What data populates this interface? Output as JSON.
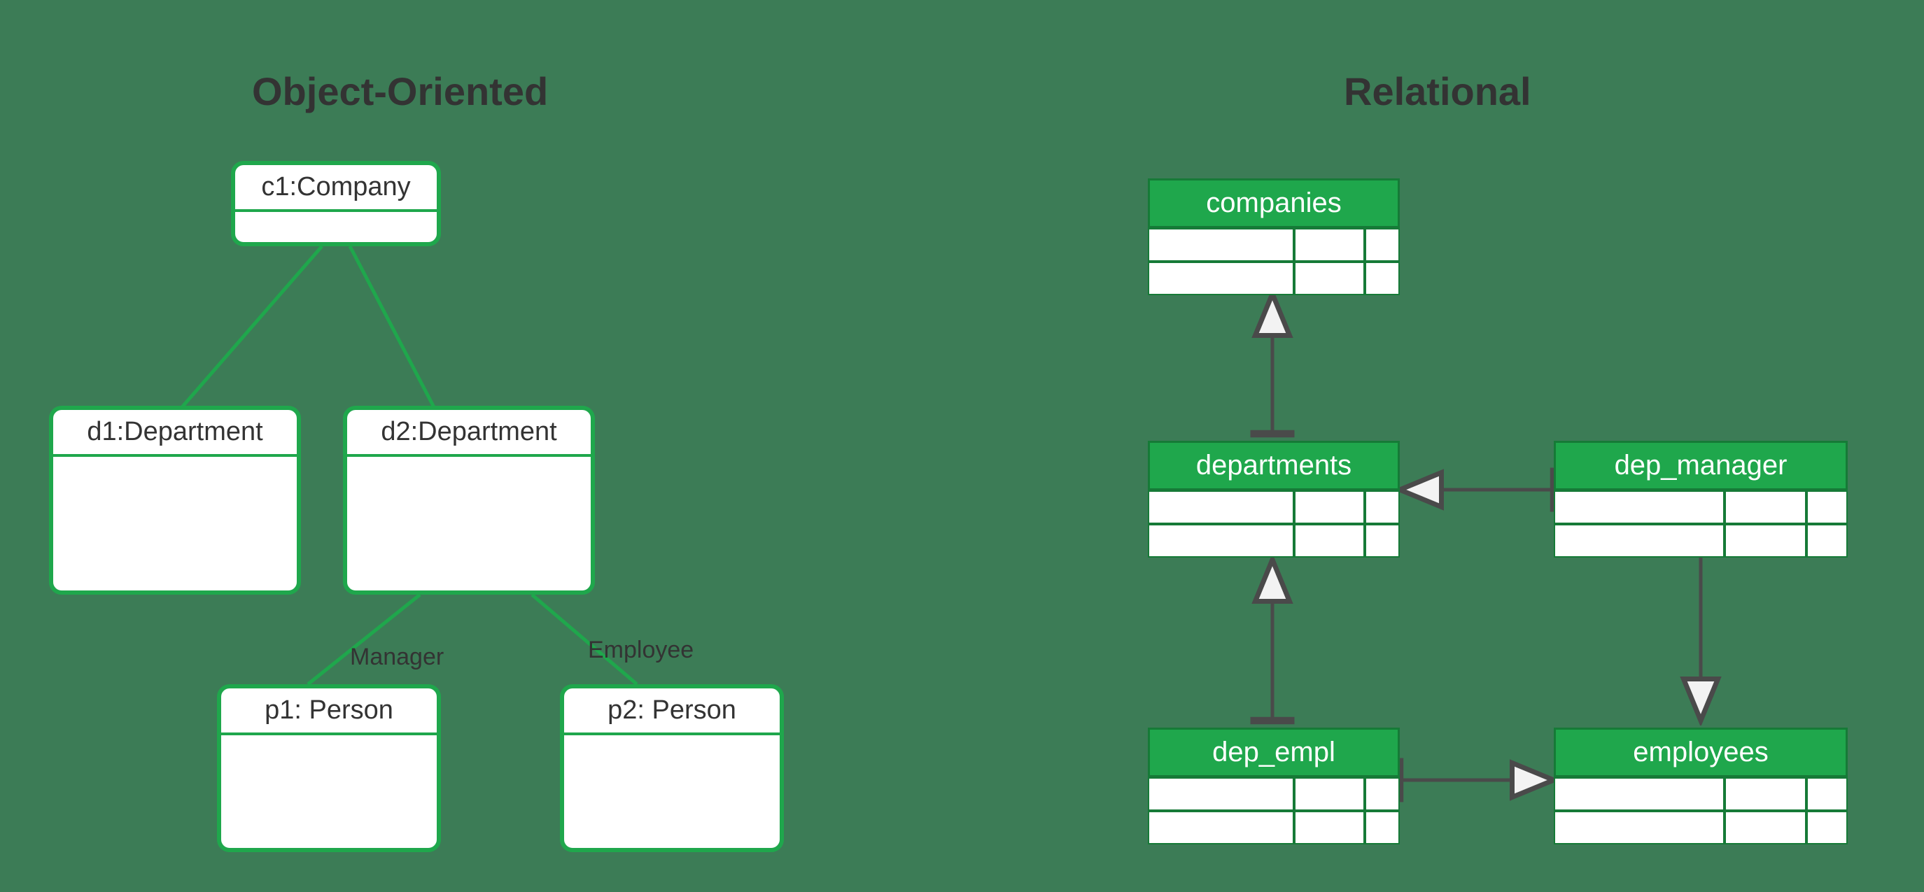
{
  "titles": {
    "left": "Object-Oriented",
    "right": "Relational"
  },
  "oo": {
    "company": {
      "label": "c1:Company"
    },
    "dept1": {
      "label": "d1:Department"
    },
    "dept2": {
      "label": "d2:Department"
    },
    "person1": {
      "label": "p1: Person"
    },
    "person2": {
      "label": "p2: Person"
    },
    "edge_manager": "Manager",
    "edge_employee": "Employee"
  },
  "rel": {
    "companies": "companies",
    "departments": "departments",
    "dep_manager": "dep_manager",
    "dep_empl": "dep_empl",
    "employees": "employees"
  },
  "colors": {
    "bg": "#3c7c56",
    "box_border": "#1fa74c",
    "table_header_bg": "#1fa74c",
    "table_border": "#167a37",
    "text": "#333333",
    "arrow": "#4a4a4a"
  },
  "chart_data": {
    "type": "table",
    "diagrams": [
      {
        "name": "Object-Oriented",
        "style": "UML object diagram",
        "nodes": [
          {
            "id": "c1",
            "label": "c1:Company",
            "type": "Company"
          },
          {
            "id": "d1",
            "label": "d1:Department",
            "type": "Department"
          },
          {
            "id": "d2",
            "label": "d2:Department",
            "type": "Department"
          },
          {
            "id": "p1",
            "label": "p1: Person",
            "type": "Person"
          },
          {
            "id": "p2",
            "label": "p2: Person",
            "type": "Person"
          }
        ],
        "edges": [
          {
            "from": "c1",
            "to": "d1",
            "label": ""
          },
          {
            "from": "c1",
            "to": "d2",
            "label": ""
          },
          {
            "from": "d2",
            "to": "p1",
            "label": "Manager"
          },
          {
            "from": "d2",
            "to": "p2",
            "label": "Employee"
          }
        ]
      },
      {
        "name": "Relational",
        "style": "ER / relational tables",
        "nodes": [
          {
            "id": "companies",
            "label": "companies"
          },
          {
            "id": "departments",
            "label": "departments"
          },
          {
            "id": "dep_manager",
            "label": "dep_manager"
          },
          {
            "id": "dep_empl",
            "label": "dep_empl"
          },
          {
            "id": "employees",
            "label": "employees"
          }
        ],
        "edges": [
          {
            "from": "departments",
            "to": "companies",
            "head": "arrow"
          },
          {
            "from": "dep_manager",
            "to": "departments",
            "head": "arrow"
          },
          {
            "from": "dep_manager",
            "to": "employees",
            "head": "arrow"
          },
          {
            "from": "dep_empl",
            "to": "departments",
            "head": "arrow"
          },
          {
            "from": "dep_empl",
            "to": "employees",
            "head": "arrow"
          }
        ]
      }
    ]
  }
}
